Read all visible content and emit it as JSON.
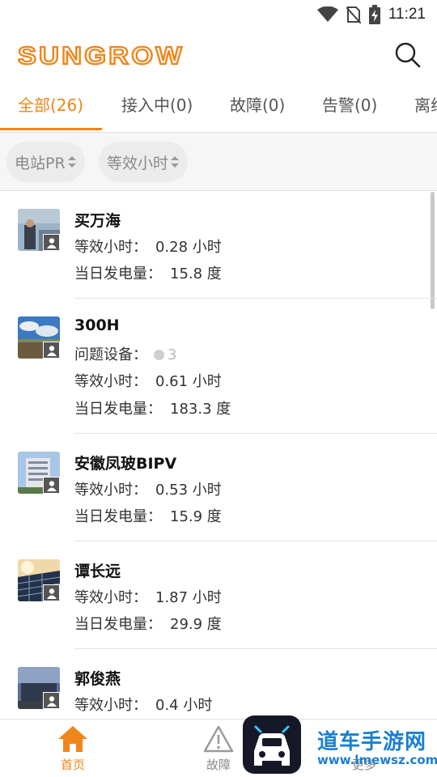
{
  "status_bar": {
    "time": "11:21"
  },
  "header": {
    "logo_text": "SUNGROW"
  },
  "tabs": [
    {
      "label": "全部(26)",
      "active": true
    },
    {
      "label": "接入中(0)",
      "active": false
    },
    {
      "label": "故障(0)",
      "active": false
    },
    {
      "label": "告警(0)",
      "active": false
    },
    {
      "label": "离线",
      "active": false
    }
  ],
  "filters": [
    {
      "label": "电站PR"
    },
    {
      "label": "等效小时"
    }
  ],
  "stations": [
    {
      "name": "买万海",
      "lines": [
        {
          "label": "等效小时：",
          "value": "0.28 小时"
        },
        {
          "label": "当日发电量：",
          "value": "15.8 度"
        }
      ]
    },
    {
      "name": "300H",
      "issue": {
        "label": "问题设备：",
        "count": "3"
      },
      "lines": [
        {
          "label": "等效小时：",
          "value": "0.61 小时"
        },
        {
          "label": "当日发电量：",
          "value": "183.3 度"
        }
      ]
    },
    {
      "name": "安徽凤玻BIPV",
      "lines": [
        {
          "label": "等效小时：",
          "value": "0.53 小时"
        },
        {
          "label": "当日发电量：",
          "value": "15.9 度"
        }
      ]
    },
    {
      "name": "谭长远",
      "lines": [
        {
          "label": "等效小时：",
          "value": "1.87 小时"
        },
        {
          "label": "当日发电量：",
          "value": "29.9 度"
        }
      ]
    },
    {
      "name": "郭俊燕",
      "lines": [
        {
          "label": "等效小时：",
          "value": "0.4 小时"
        }
      ]
    }
  ],
  "bottom_nav": [
    {
      "label": "首页",
      "icon": "home-icon",
      "active": true
    },
    {
      "label": "故障",
      "icon": "warning-icon",
      "active": false
    },
    {
      "label": "更多",
      "icon": "more-icon",
      "active": false
    }
  ],
  "watermark": {
    "title": "道车手游网",
    "url": "www.lmewsz.com"
  },
  "colors": {
    "accent": "#f08519",
    "watermark": "#1a7fd4"
  }
}
